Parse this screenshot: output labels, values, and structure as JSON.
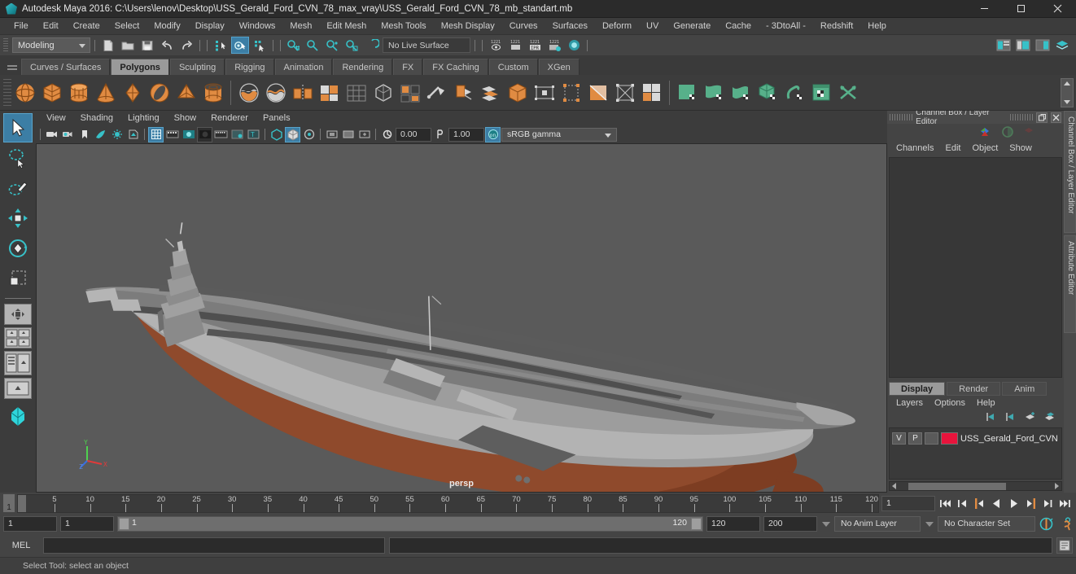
{
  "window": {
    "title": "Autodesk Maya 2016: C:\\Users\\lenov\\Desktop\\USS_Gerald_Ford_CVN_78_max_vray\\USS_Gerald_Ford_CVN_78_mb_standart.mb",
    "app_icon": "maya-icon",
    "minimize": "minimize-button",
    "maximize": "maximize-button",
    "close": "close-button"
  },
  "menubar": {
    "items": [
      {
        "label": "File"
      },
      {
        "label": "Edit"
      },
      {
        "label": "Create"
      },
      {
        "label": "Select"
      },
      {
        "label": "Modify"
      },
      {
        "label": "Display"
      },
      {
        "label": "Windows"
      },
      {
        "label": "Mesh"
      },
      {
        "label": "Edit Mesh"
      },
      {
        "label": "Mesh Tools"
      },
      {
        "label": "Mesh Display"
      },
      {
        "label": "Curves"
      },
      {
        "label": "Surfaces"
      },
      {
        "label": "Deform"
      },
      {
        "label": "UV"
      },
      {
        "label": "Generate"
      },
      {
        "label": "Cache"
      },
      {
        "label": "- 3DtoAll -"
      },
      {
        "label": "Redshift"
      },
      {
        "label": "Help"
      }
    ]
  },
  "statusline": {
    "menu_set": "Modeling",
    "live_surface": "No Live Surface",
    "icons": [
      "new-scene-icon",
      "open-scene-icon",
      "save-scene-icon",
      "undo-icon",
      "redo-icon",
      "select-by-hierarchy-icon",
      "select-by-object-icon",
      "select-by-component-icon",
      "snap-to-grid-icon",
      "snap-to-curve-icon",
      "snap-to-point-icon",
      "snap-to-projected-center-icon",
      "snap-to-view-plane-icon",
      "render-current-frame-icon",
      "render-sequence-icon",
      "ipr-render-icon",
      "render-settings-icon",
      "hypershade-icon"
    ],
    "right_icons": [
      "sidebar-attribute-editor-icon",
      "sidebar-tool-settings-icon",
      "sidebar-channel-box-icon",
      "sidebar-layers-icon"
    ]
  },
  "shelf": {
    "tabs": [
      {
        "label": "Curves / Surfaces",
        "active": false
      },
      {
        "label": "Polygons",
        "active": true
      },
      {
        "label": "Sculpting",
        "active": false
      },
      {
        "label": "Rigging",
        "active": false
      },
      {
        "label": "Animation",
        "active": false
      },
      {
        "label": "Rendering",
        "active": false
      },
      {
        "label": "FX",
        "active": false
      },
      {
        "label": "FX Caching",
        "active": false
      },
      {
        "label": "Custom",
        "active": false
      },
      {
        "label": "XGen",
        "active": false
      }
    ],
    "icons": [
      "poly-sphere-icon",
      "poly-cube-icon",
      "poly-cylinder-icon",
      "poly-cone-icon",
      "poly-platonic-icon",
      "poly-torus-icon",
      "poly-pyramid-icon",
      "poly-pipe-icon",
      "boolean-union-icon",
      "boolean-difference-icon",
      "mirror-geometry-icon",
      "combine-icon",
      "separate-icon",
      "smooth-icon",
      "extrude-icon",
      "bevel-icon",
      "multi-cut-icon",
      "target-weld-icon",
      "bridge-icon",
      "fill-hole-icon",
      "append-polygon-icon",
      "insert-edge-loop-icon",
      "offset-edge-loop-icon",
      "poly-split-icon",
      "quad-draw-icon",
      "uv-planar-icon",
      "uv-cylindrical-icon",
      "uv-spherical-icon",
      "uv-automatic-icon",
      "uv-unfold-icon",
      "uv-editor-icon",
      "uv-cut-icon"
    ]
  },
  "toolbox": {
    "tools": [
      {
        "name": "select-tool",
        "active": true
      },
      {
        "name": "lasso-select-tool",
        "active": false
      },
      {
        "name": "paint-select-tool",
        "active": false
      },
      {
        "name": "move-tool",
        "active": false
      },
      {
        "name": "rotate-tool",
        "active": false
      },
      {
        "name": "scale-tool",
        "active": false
      }
    ],
    "layouts": [
      "single-perspective-layout",
      "four-view-layout",
      "outliner-persp-layout",
      "hypergraph-persp-layout",
      "persp-graph-layout"
    ]
  },
  "viewport": {
    "panel_menus": [
      {
        "label": "View"
      },
      {
        "label": "Shading"
      },
      {
        "label": "Lighting"
      },
      {
        "label": "Show"
      },
      {
        "label": "Renderer"
      },
      {
        "label": "Panels"
      }
    ],
    "camera_label": "persp",
    "exposure": "0.00",
    "gamma": "1.00",
    "color_management": "sRGB gamma",
    "toolbar_icons": [
      "select-camera-icon",
      "camera-attributes-icon",
      "bookmark-icon",
      "image-plane-icon",
      "two-sided-lighting-icon",
      "shadows-icon",
      "wireframe-icon",
      "smooth-shade-icon",
      "shaded-icon",
      "textured-icon",
      "lights-icon",
      "xray-icon",
      "xray-joints-icon",
      "isolate-select-icon",
      "grid-icon",
      "film-gate-icon",
      "resolution-gate-icon",
      "exposure-icon",
      "gamma-icon",
      "color-management-toggle-icon"
    ],
    "model": {
      "name": "USS_Gerald_Ford_CVN_78",
      "hull_color": "#8f4a2c",
      "deck_color": "#8c8c8c",
      "flightdeck_color": "#6e6e6e",
      "background_color": "#5a5a5a"
    },
    "axis": {
      "x": "X",
      "y": "Y",
      "z": "Z"
    }
  },
  "channel_box": {
    "title": "Channel Box / Layer Editor",
    "menus": [
      {
        "label": "Channels"
      },
      {
        "label": "Edit"
      },
      {
        "label": "Object"
      },
      {
        "label": "Show"
      }
    ],
    "icons": [
      "channel-box-icon",
      "attribute-editor-icon",
      "layer-editor-icon"
    ],
    "window_buttons": [
      "undock-button",
      "close-button"
    ]
  },
  "layer_editor": {
    "tabs": [
      {
        "label": "Display",
        "active": true
      },
      {
        "label": "Render",
        "active": false
      },
      {
        "label": "Anim",
        "active": false
      }
    ],
    "menus": [
      {
        "label": "Layers"
      },
      {
        "label": "Options"
      },
      {
        "label": "Help"
      }
    ],
    "toolbar_icons": [
      "move-layer-up-icon",
      "move-layer-down-icon",
      "new-layer-icon",
      "new-layer-from-selected-icon"
    ],
    "layers": [
      {
        "visibility": "V",
        "playback": "P",
        "display_type": "",
        "color": "#e8143c",
        "name": "USS_Gerald_Ford_CVN"
      }
    ]
  },
  "side_tabs": [
    {
      "label": "Channel Box / Layer Editor"
    },
    {
      "label": "Attribute Editor"
    }
  ],
  "timeline": {
    "start": 1,
    "end": 120,
    "current_frame": "1",
    "ticks": [
      5,
      10,
      15,
      20,
      25,
      30,
      35,
      40,
      45,
      50,
      55,
      60,
      65,
      70,
      75,
      80,
      85,
      90,
      95,
      100,
      105,
      110,
      115,
      120
    ],
    "current_frame_field": "1",
    "transport_buttons": [
      "go-to-start-icon",
      "step-back-frame-icon",
      "step-back-key-icon",
      "play-backwards-icon",
      "play-forwards-icon",
      "step-forward-key-icon",
      "step-forward-frame-icon",
      "go-to-end-icon"
    ]
  },
  "range_slider": {
    "anim_start": "1",
    "playback_start": "1",
    "bar_start_label": "1",
    "bar_end_label": "120",
    "playback_end": "120",
    "anim_end": "200",
    "anim_layer": "No Anim Layer",
    "character_set": "No Character Set",
    "icons": [
      "auto-keyframe-icon",
      "animation-preferences-icon"
    ]
  },
  "command_line": {
    "language_label": "MEL",
    "input_value": "",
    "input_placeholder": "",
    "output_value": "",
    "script_editor_icon": "script-editor-icon"
  },
  "help_line": {
    "text": "Select Tool: select an object"
  }
}
